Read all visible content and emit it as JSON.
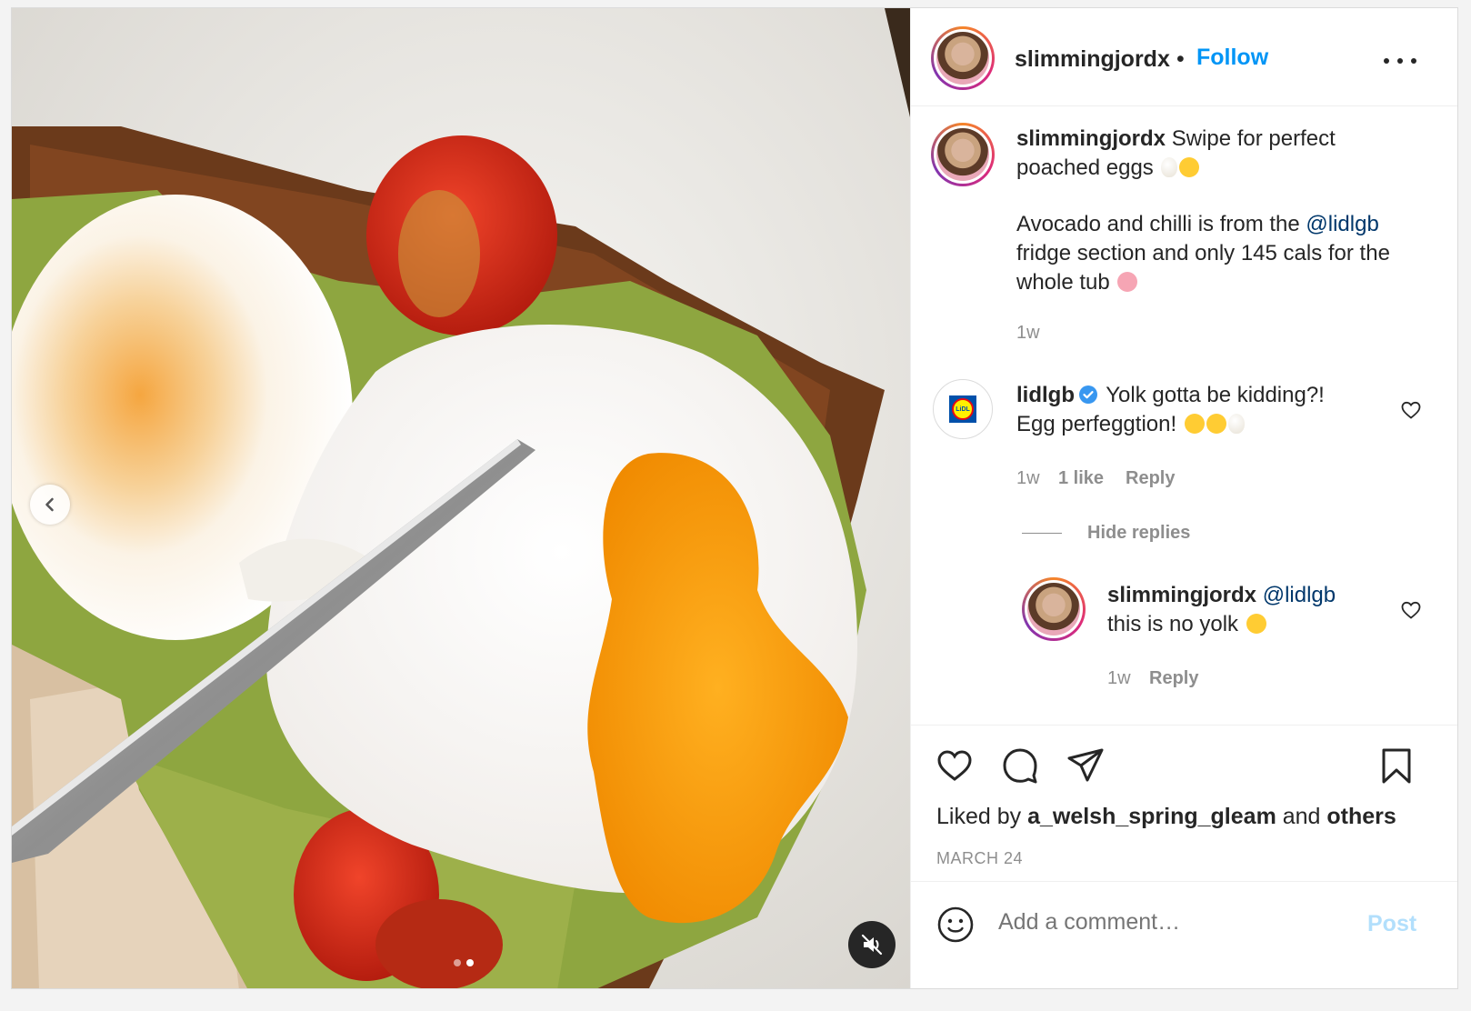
{
  "header": {
    "username": "slimmingjordx",
    "separator": "•",
    "follow_label": "Follow"
  },
  "caption": {
    "username": "slimmingjordx",
    "line1": "Swipe for perfect",
    "line2": "poached eggs",
    "para2_line1_prefix": "Avocado and chilli is from the ",
    "para2_mention": "@lidlgb",
    "para2_line2": "fridge section and only 145 cals for the",
    "para2_line3": "whole tub",
    "time": "1w"
  },
  "comment1": {
    "username": "lidlgb",
    "logo_text": "LiDL",
    "line1": "Yolk gotta be kidding?!",
    "line2": "Egg perfeggtion!",
    "time": "1w",
    "likes": "1 like",
    "reply_label": "Reply",
    "hide_replies": "Hide replies"
  },
  "reply1": {
    "username": "slimmingjordx",
    "mention": "@lidlgb",
    "text": "this is no yolk",
    "time": "1w",
    "reply_label": "Reply"
  },
  "likes": {
    "prefix": "Liked by ",
    "user": "a_welsh_spring_gleam",
    "middle": " and ",
    "others": "others"
  },
  "date": "MARCH 24",
  "comment_box": {
    "placeholder": "Add a comment…",
    "post_label": "Post"
  },
  "media": {
    "carousel_count": 2,
    "active_index": 1
  },
  "colors": {
    "accent": "#0095f6",
    "post_disabled": "#b2dffc",
    "mention": "#00376b",
    "secondary_text": "#8e8e8e"
  }
}
